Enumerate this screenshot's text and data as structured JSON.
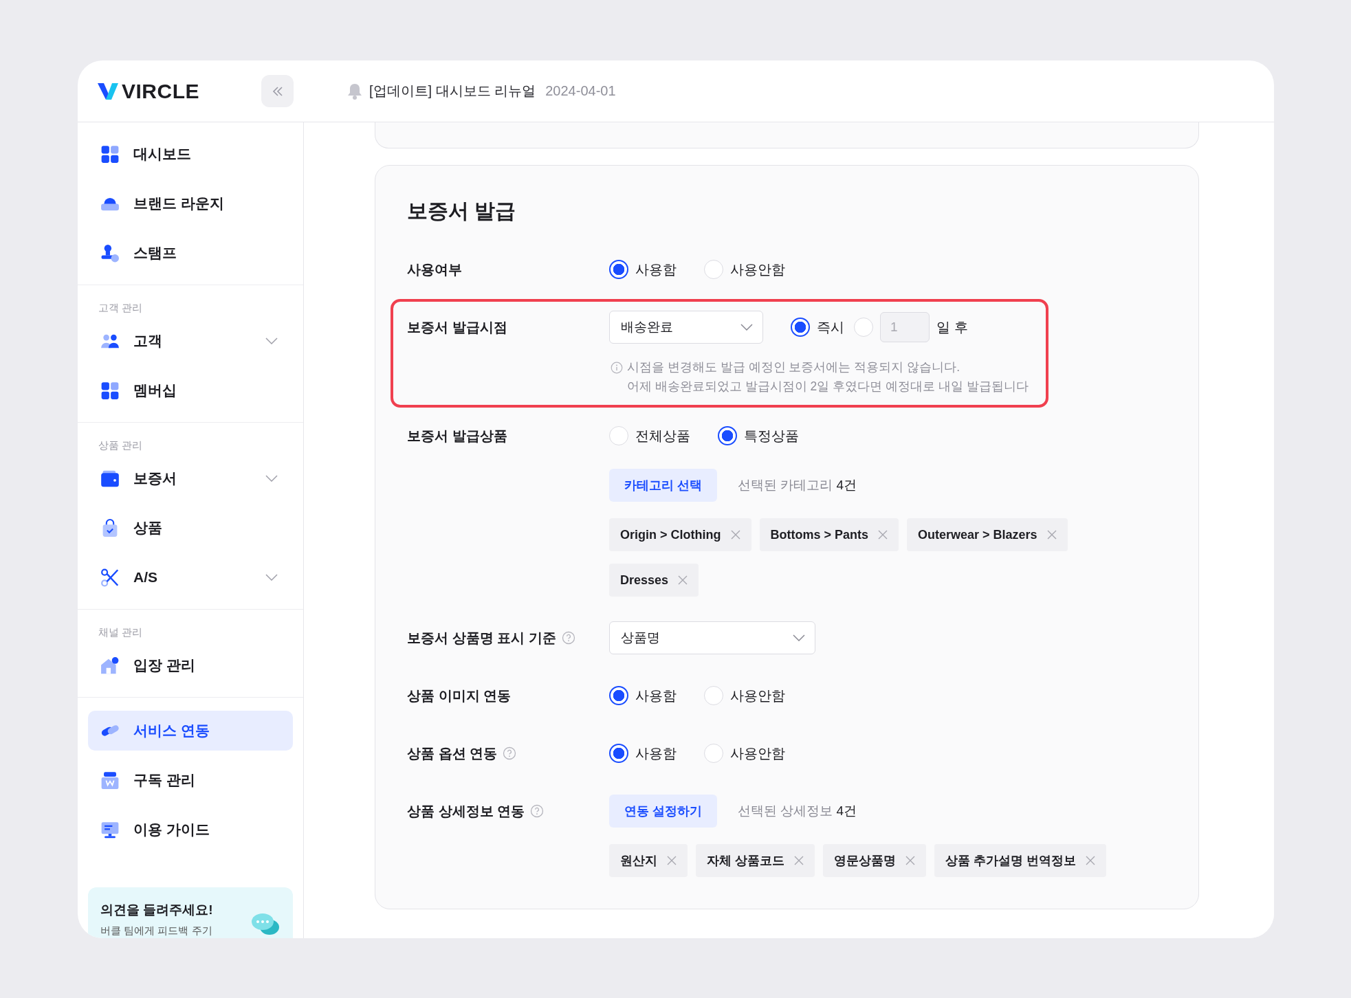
{
  "header": {
    "logo": "VIRCLE",
    "notice": "[업데이트] 대시보드 리뉴얼",
    "date": "2024-04-01"
  },
  "sidebar": {
    "groups": [
      {
        "items": [
          {
            "label": "대시보드",
            "expandable": false,
            "selected": false
          },
          {
            "label": "브랜드 라운지",
            "expandable": false,
            "selected": false
          },
          {
            "label": "스탬프",
            "expandable": false,
            "selected": false
          }
        ]
      },
      {
        "label": "고객 관리",
        "items": [
          {
            "label": "고객",
            "expandable": true,
            "selected": false
          },
          {
            "label": "멤버십",
            "expandable": false,
            "selected": false
          }
        ]
      },
      {
        "label": "상품 관리",
        "items": [
          {
            "label": "보증서",
            "expandable": true,
            "selected": false
          },
          {
            "label": "상품",
            "expandable": false,
            "selected": false
          },
          {
            "label": "A/S",
            "expandable": true,
            "selected": false
          }
        ]
      },
      {
        "label": "채널 관리",
        "items": [
          {
            "label": "입장 관리",
            "expandable": false,
            "selected": false
          }
        ]
      },
      {
        "items": [
          {
            "label": "서비스 연동",
            "expandable": false,
            "selected": true
          },
          {
            "label": "구독 관리",
            "expandable": false,
            "selected": false
          },
          {
            "label": "이용 가이드",
            "expandable": false,
            "selected": false
          }
        ]
      }
    ],
    "feedback": {
      "title": "의견을 들려주세요!",
      "text": "버클 팀에게 피드백 주기"
    }
  },
  "main": {
    "title": "보증서 발급",
    "rows": [
      {
        "label": "사용여부",
        "help": false,
        "highlighted": false,
        "options": [
          {
            "label": "사용함",
            "selected": true
          },
          {
            "label": "사용안함",
            "selected": false
          }
        ]
      },
      {
        "label": "보증서 발급시점",
        "help": false,
        "highlighted": true,
        "select": "배송완료",
        "options": [
          {
            "label": "즉시",
            "selected": true
          },
          {
            "input": "1",
            "disabled": true,
            "suffix": "일 후",
            "selected": false
          }
        ],
        "notes": [
          "시점을 변경해도 발급 예정인 보증서에는 적용되지 않습니다.",
          "어제 배송완료되었고 발급시점이 2일 후였다면 예정대로 내일 발급됩니다"
        ]
      },
      {
        "label": "보증서 발급상품",
        "help": false,
        "highlighted": false,
        "options": [
          {
            "label": "전체상품",
            "selected": false
          },
          {
            "label": "특정상품",
            "selected": true
          }
        ],
        "button": "카테고리 선택",
        "summary": {
          "text": "선택된 카테고리",
          "count": "4건"
        },
        "chips": [
          "Origin > Clothing",
          "Bottoms > Pants",
          "Outerwear > Blazers",
          "Dresses"
        ]
      },
      {
        "label": "보증서 상품명 표시 기준",
        "help": true,
        "highlighted": false,
        "select": "상품명"
      },
      {
        "label": "상품 이미지 연동",
        "help": false,
        "highlighted": false,
        "options": [
          {
            "label": "사용함",
            "selected": true
          },
          {
            "label": "사용안함",
            "selected": false
          }
        ]
      },
      {
        "label": "상품 옵션 연동",
        "help": true,
        "highlighted": false,
        "options": [
          {
            "label": "사용함",
            "selected": true
          },
          {
            "label": "사용안함",
            "selected": false
          }
        ]
      },
      {
        "label": "상품 상세정보 연동",
        "help": true,
        "highlighted": false,
        "button": "연동 설정하기",
        "summary": {
          "text": "선택된 상세정보",
          "count": "4건"
        },
        "chips": [
          "원산지",
          "자체 상품코드",
          "영문상품명",
          "상품 추가설명 번역정보"
        ]
      }
    ]
  }
}
